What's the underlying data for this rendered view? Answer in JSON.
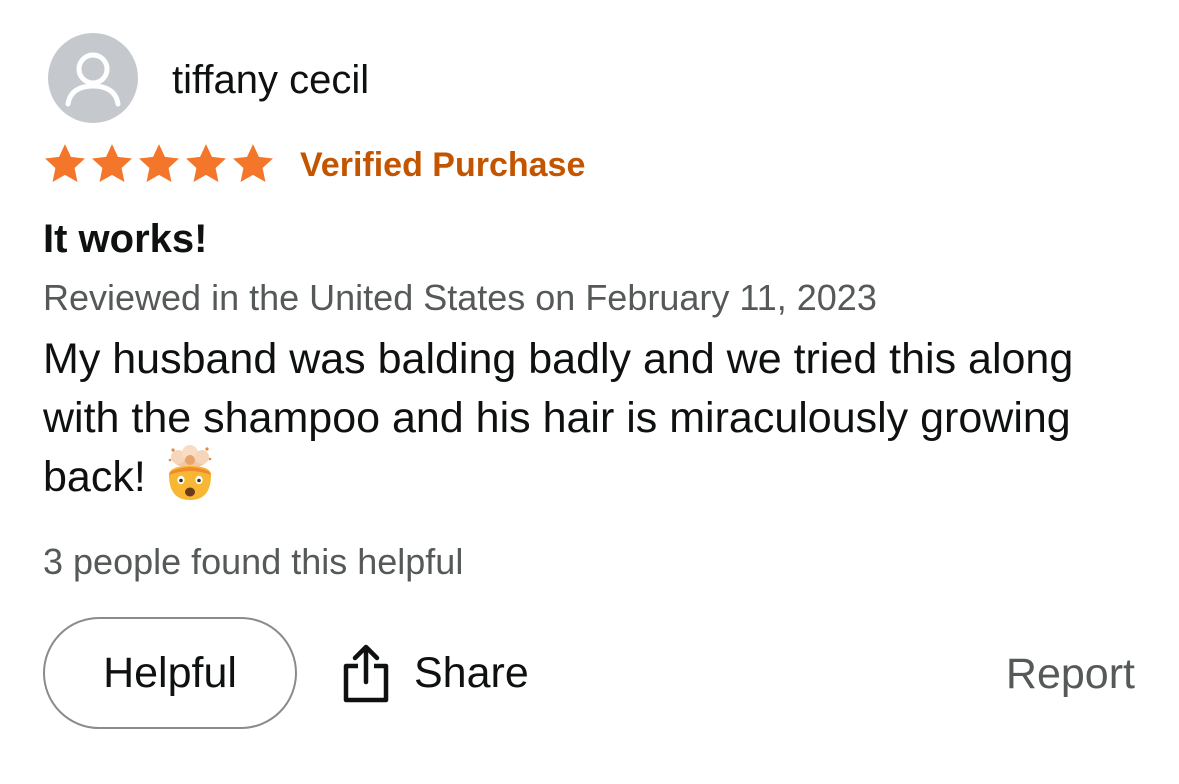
{
  "reviewer": {
    "name": "tiffany cecil",
    "avatar_icon": "default-user-avatar-icon"
  },
  "rating": {
    "stars": 5,
    "max": 5,
    "star_color": "#f3762a",
    "badge": "Verified Purchase",
    "badge_color": "#c45500"
  },
  "review": {
    "title": "It works!",
    "meta": "Reviewed in the United States on February 11, 2023",
    "body": "My husband was balding badly and we tried this along with the shampoo and his hair is miraculously growing back!",
    "emoji_icon": "exploding-head-emoji-icon"
  },
  "helpfulness": {
    "count_text": "3 people found this helpful"
  },
  "actions": {
    "helpful_label": "Helpful",
    "share_label": "Share",
    "share_icon": "share-icon",
    "report_label": "Report"
  }
}
